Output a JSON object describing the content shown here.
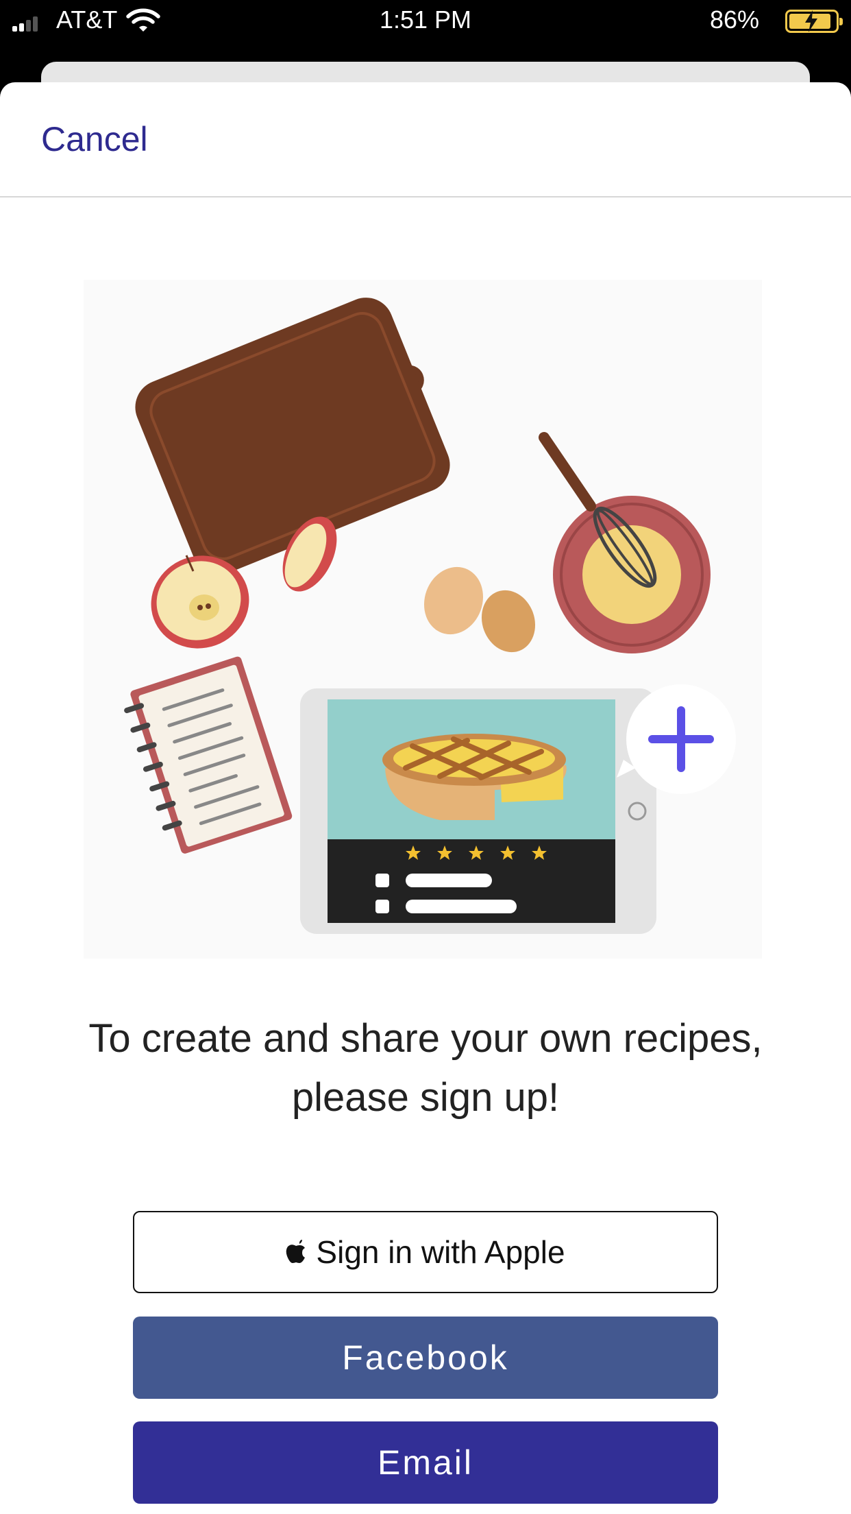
{
  "status_bar": {
    "carrier": "AT&T",
    "time": "1:51 PM",
    "battery_percent": "86%",
    "signal_bars": 2,
    "battery_level": 0.86,
    "charging": true
  },
  "nav": {
    "cancel_label": "Cancel"
  },
  "illustration": {
    "icons": [
      "cutting-board-icon",
      "apple-slice-icon",
      "egg-icon",
      "whisk-bowl-icon",
      "notebook-icon",
      "tablet-icon",
      "pie-icon",
      "star-icon",
      "plus-icon"
    ],
    "rating_stars": 5
  },
  "main": {
    "message": "To create and share your own recipes, please sign up!"
  },
  "buttons": {
    "apple": "Sign in with Apple",
    "facebook": "Facebook",
    "email": "Email"
  },
  "colors": {
    "accent": "#2e2a8f",
    "facebook": "#435890",
    "email": "#322f96",
    "plus": "#5b50e6"
  }
}
